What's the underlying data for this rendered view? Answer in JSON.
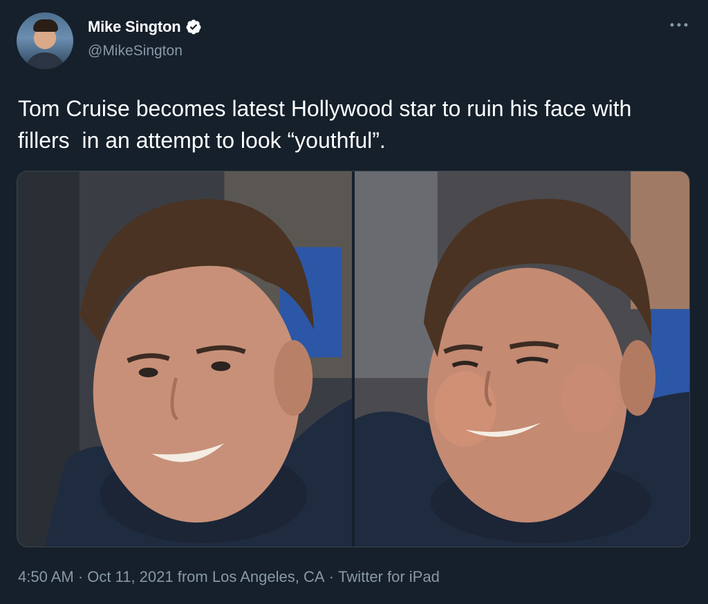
{
  "author": {
    "display_name": "Mike Sington",
    "handle": "@MikeSington",
    "verified": true,
    "avatar_icon": "profile-photo"
  },
  "tweet": {
    "text": "Tom Cruise becomes latest Hollywood star to ruin his face with fillers  in an attempt to look “youthful”."
  },
  "media": [
    {
      "icon": "photo-left"
    },
    {
      "icon": "photo-right"
    }
  ],
  "meta": {
    "time": "4:50 AM",
    "sep1": " · ",
    "date": "Oct 11, 2021",
    "from_prefix": " from ",
    "location": "Los Angeles, CA",
    "sep2": " · ",
    "source": "Twitter for iPad"
  },
  "colors": {
    "background": "#15202b",
    "secondary_text": "#8899a6",
    "verified": "#ffffff"
  },
  "icons": {
    "more": "more-horizontal-icon",
    "verified": "verified-badge-icon"
  }
}
